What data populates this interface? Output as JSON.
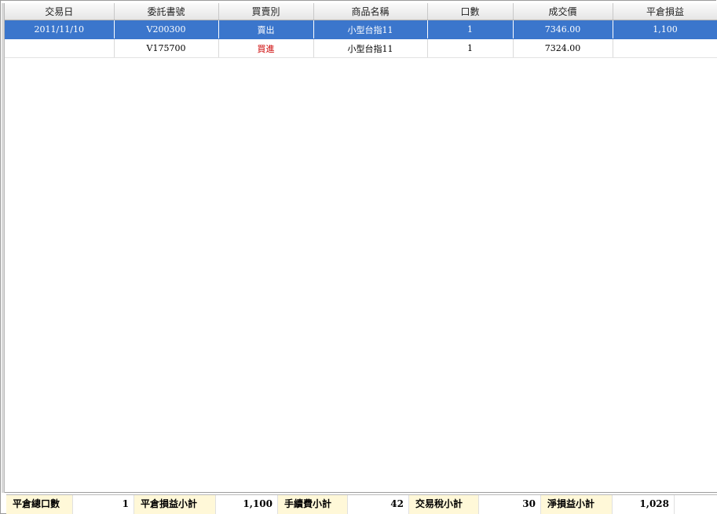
{
  "columns": [
    "交易日",
    "委託書號",
    "買賣別",
    "商品名稱",
    "口數",
    "成交價",
    "平倉損益"
  ],
  "rows": [
    {
      "date": "2011/11/10",
      "order_no": "V200300",
      "side": "賣出",
      "product": "小型台指11",
      "lots": "1",
      "price": "7346.00",
      "pnl": "1,100"
    },
    {
      "date": "",
      "order_no": "V175700",
      "side": "買進",
      "product": "小型台指11",
      "lots": "1",
      "price": "7324.00",
      "pnl": ""
    }
  ],
  "summary": {
    "total_lots_label": "平倉總口數",
    "total_lots_value": "1",
    "pnl_subtotal_label": "平倉損益小計",
    "pnl_subtotal_value": "1,100",
    "fee_subtotal_label": "手續費小計",
    "fee_subtotal_value": "42",
    "tax_subtotal_label": "交易稅小計",
    "tax_subtotal_value": "30",
    "net_pnl_label": "淨損益小計",
    "net_pnl_value": "1,028"
  },
  "colors": {
    "selected_row": "#3b76cc",
    "buy_text": "#cc0000",
    "summary_label_bg": "#fff8d8"
  }
}
